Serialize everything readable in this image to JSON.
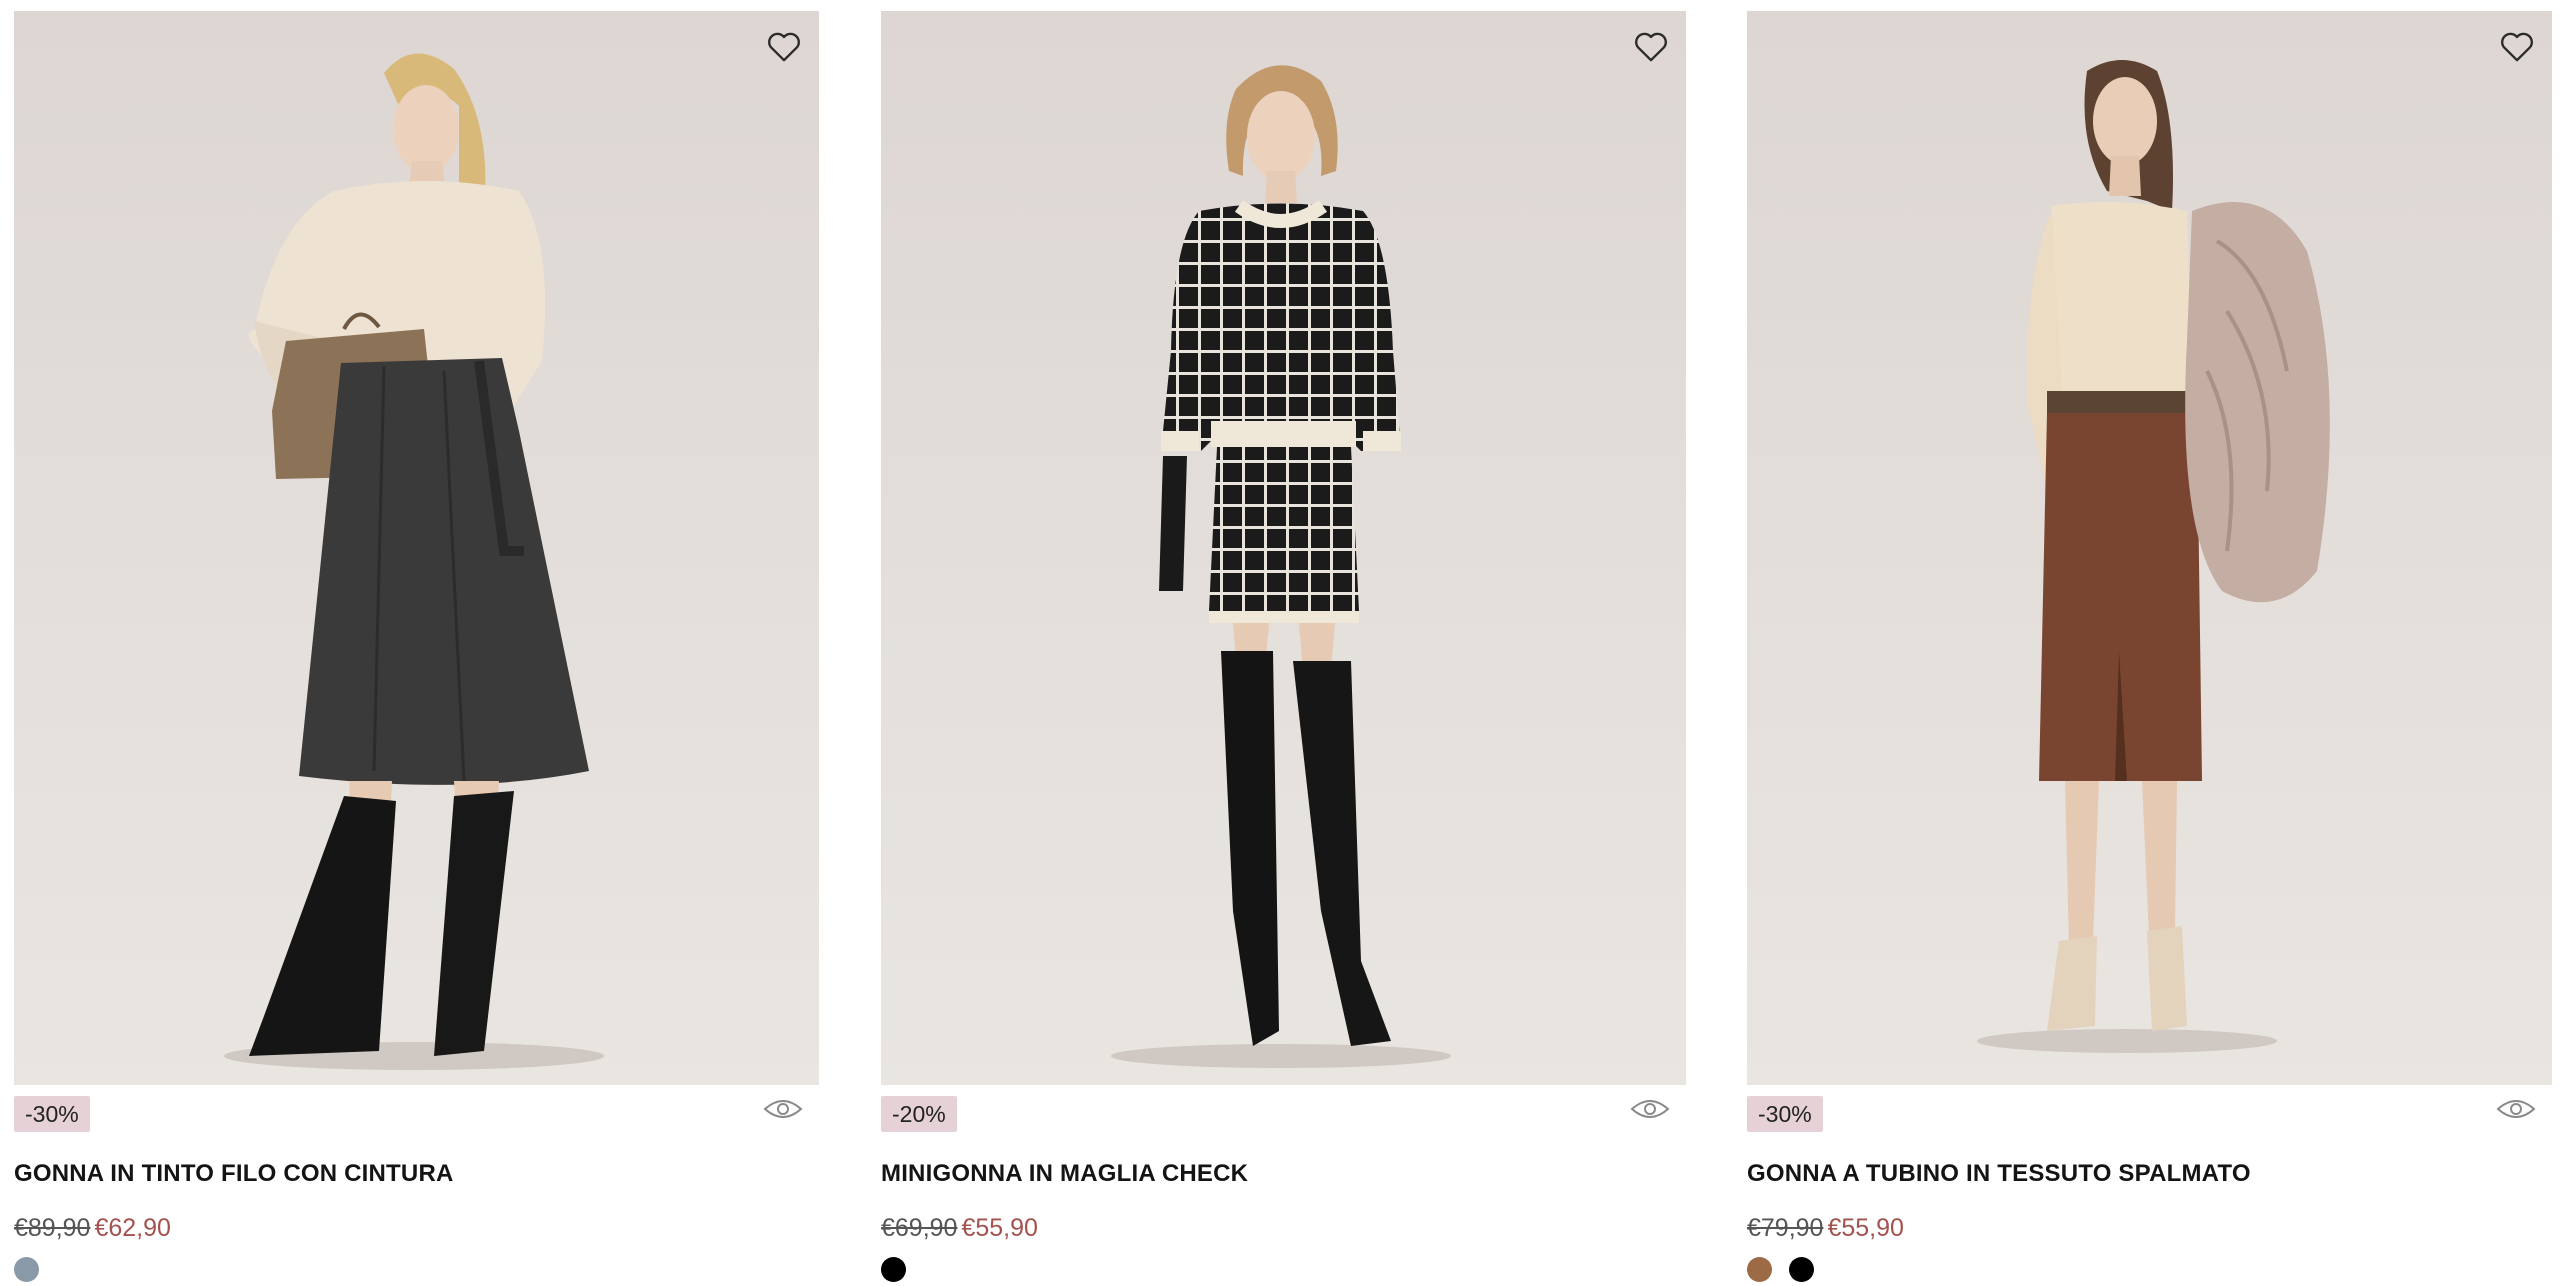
{
  "products": [
    {
      "discount": "-30%",
      "title": "GONNA IN TINTO FILO CON CINTURA",
      "old_price": "€89,90",
      "new_price": "€62,90",
      "swatches": [
        "#8a99a8"
      ],
      "image": "model-beige-sweater-dark-skirt"
    },
    {
      "discount": "-20%",
      "title": "MINIGONNA IN MAGLIA CHECK",
      "old_price": "€69,90",
      "new_price": "€55,90",
      "swatches": [
        "#000000"
      ],
      "image": "model-check-knit-set-boots"
    },
    {
      "discount": "-30%",
      "title": "GONNA A TUBINO IN TESSUTO SPALMATO",
      "old_price": "€79,90",
      "new_price": "€55,90",
      "swatches": [
        "#9c6a45",
        "#000000"
      ],
      "image": "model-brown-leather-skirt-fur"
    }
  ],
  "icons": {
    "wishlist": "heart-icon",
    "quick_view": "eye-icon"
  },
  "colors": {
    "badge_bg": "#e6d1d6",
    "sale_price": "#a3524d"
  }
}
